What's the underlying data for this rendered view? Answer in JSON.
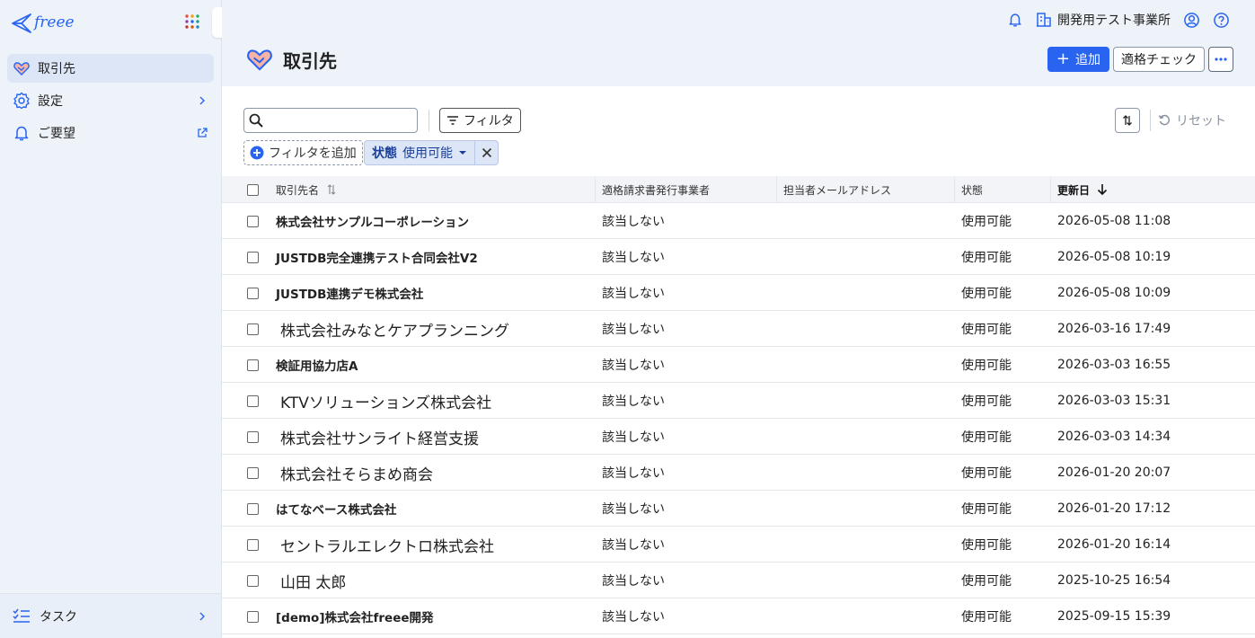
{
  "sidebar": {
    "logo_text": "freee",
    "items": [
      {
        "label": "取引先",
        "icon": "handshake-icon",
        "active": true
      },
      {
        "label": "設定",
        "icon": "gear-icon",
        "trail": "chevron-right-icon"
      },
      {
        "label": "ご要望",
        "icon": "bell-icon",
        "trail": "external-link-icon"
      }
    ],
    "task_label": "タスク"
  },
  "header": {
    "org_name": "開発用テスト事業所",
    "page_title": "取引先",
    "add_label": "追加",
    "check_label": "適格チェック"
  },
  "toolbar": {
    "search_placeholder": "",
    "filter_label": "フィルタ",
    "reset_label": "リセット",
    "add_filter_label": "フィルタを追加",
    "chip_key": "状態",
    "chip_value": "使用可能"
  },
  "table": {
    "columns": [
      "取引先名",
      "適格請求書発行事業者",
      "担当者メールアドレス",
      "状態",
      "更新日"
    ],
    "rows": [
      {
        "name": "株式会社サンプルコーポレーション",
        "bold": true,
        "qualified": "該当しない",
        "email": "",
        "status": "使用可能",
        "updated": "2026-05-08 11:08"
      },
      {
        "name": "JUSTDB完全連携テスト合同会社V2",
        "bold": true,
        "qualified": "該当しない",
        "email": "",
        "status": "使用可能",
        "updated": "2026-05-08 10:19"
      },
      {
        "name": "JUSTDB連携デモ株式会社",
        "bold": true,
        "qualified": "該当しない",
        "email": "",
        "status": "使用可能",
        "updated": "2026-05-08 10:09"
      },
      {
        "name": "株式会社みなとケアプランニング",
        "bold": false,
        "qualified": "該当しない",
        "email": "",
        "status": "使用可能",
        "updated": "2026-03-16 17:49"
      },
      {
        "name": "検証用協力店A",
        "bold": true,
        "qualified": "該当しない",
        "email": "",
        "status": "使用可能",
        "updated": "2026-03-03 16:55"
      },
      {
        "name": "KTVソリューションズ株式会社",
        "bold": false,
        "qualified": "該当しない",
        "email": "",
        "status": "使用可能",
        "updated": "2026-03-03 15:31"
      },
      {
        "name": "株式会社サンライト経営支援",
        "bold": false,
        "qualified": "該当しない",
        "email": "",
        "status": "使用可能",
        "updated": "2026-03-03 14:34"
      },
      {
        "name": "株式会社そらまめ商会",
        "bold": false,
        "qualified": "該当しない",
        "email": "",
        "status": "使用可能",
        "updated": "2026-01-20 20:07"
      },
      {
        "name": "はてなベース株式会社",
        "bold": true,
        "qualified": "該当しない",
        "email": "",
        "status": "使用可能",
        "updated": "2026-01-20 17:12"
      },
      {
        "name": "セントラルエレクトロ株式会社",
        "bold": false,
        "qualified": "該当しない",
        "email": "",
        "status": "使用可能",
        "updated": "2026-01-20 16:14"
      },
      {
        "name": "山田 太郎",
        "bold": false,
        "qualified": "該当しない",
        "email": "",
        "status": "使用可能",
        "updated": "2025-10-25 16:54"
      },
      {
        "name": "[demo]株式会社freee開発",
        "bold": true,
        "qualified": "該当しない",
        "email": "",
        "status": "使用可能",
        "updated": "2025-09-15 15:39"
      }
    ]
  },
  "colors": {
    "brand": "#2864f0",
    "sidebar_bg": "#eef3fa",
    "active_bg": "#dde6f6",
    "chip_bg": "#dde6f6"
  }
}
